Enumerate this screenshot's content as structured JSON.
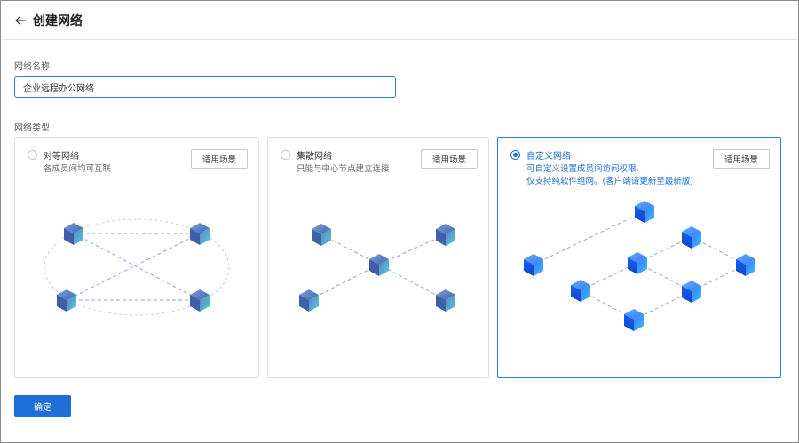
{
  "header": {
    "title": "创建网络"
  },
  "form": {
    "name_label": "网络名称",
    "name_value": "企业远程办公网络",
    "type_label": "网络类型"
  },
  "cards": [
    {
      "title": "对等网络",
      "desc": "各成员间均可互联",
      "button": "适用场景",
      "selected": false
    },
    {
      "title": "集散网络",
      "desc": "只能与中心节点建立连接",
      "button": "适用场景",
      "selected": false
    },
    {
      "title": "自定义网络",
      "desc_line1": "可自定义设置成员间访问权限,",
      "desc_line2": "仅支持纯软件组网。(客户端请更新至最新版)",
      "button": "适用场景",
      "selected": true
    }
  ],
  "actions": {
    "confirm_label": "确定"
  },
  "colors": {
    "accent": "#1e6fd6",
    "cube_gray": "#5a7fbf",
    "cube_blue": "#1f6ff5"
  }
}
